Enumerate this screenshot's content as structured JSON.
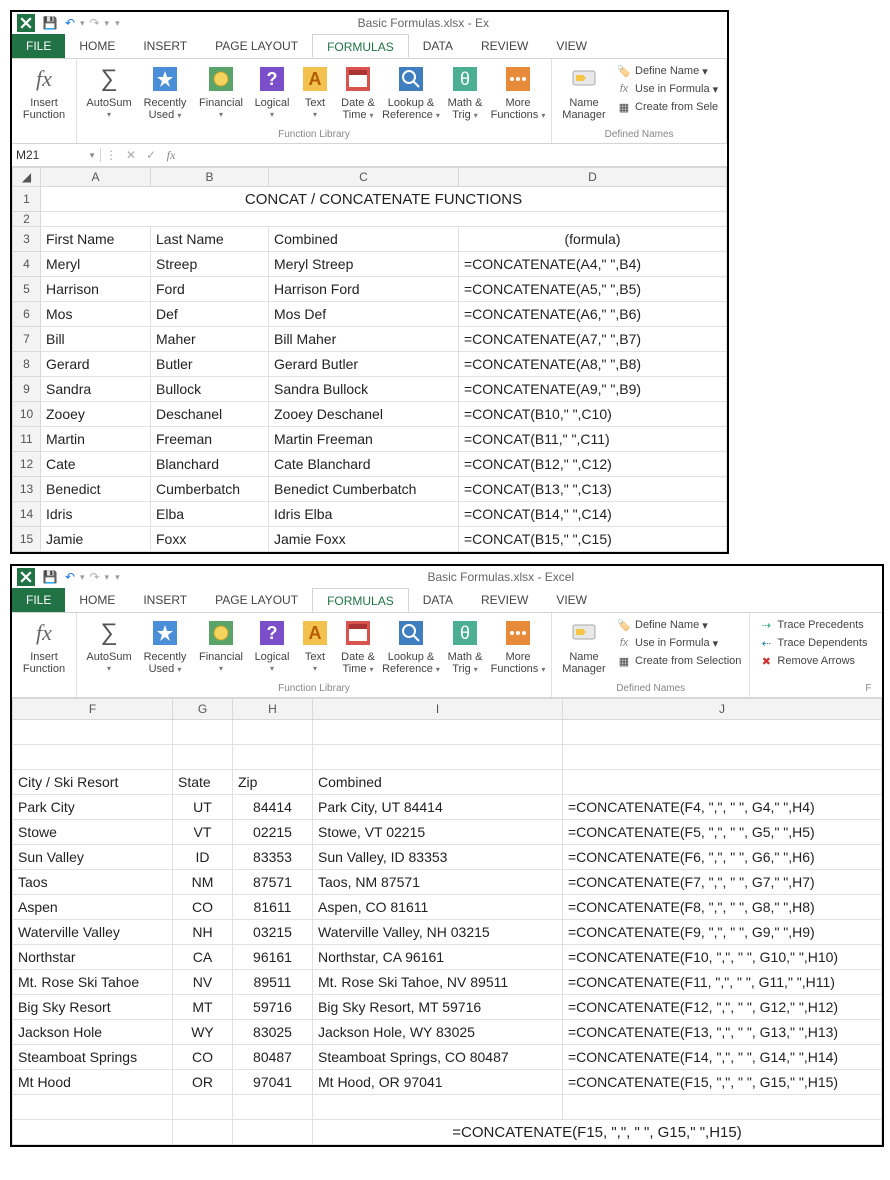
{
  "app_title": "Basic Formulas.xlsx - Ex",
  "app_title_full": "Basic Formulas.xlsx - Excel",
  "tabs": [
    "FILE",
    "HOME",
    "INSERT",
    "PAGE LAYOUT",
    "FORMULAS",
    "DATA",
    "REVIEW",
    "VIEW"
  ],
  "namebox": "M21",
  "formula_input": "",
  "ribbon": {
    "insert_function": {
      "l1": "Insert",
      "l2": "Function"
    },
    "autosum": {
      "l1": "AutoSum"
    },
    "recently": {
      "l1": "Recently",
      "l2": "Used"
    },
    "financial": {
      "l1": "Financial"
    },
    "logical": {
      "l1": "Logical"
    },
    "text": {
      "l1": "Text"
    },
    "datetime": {
      "l1": "Date &",
      "l2": "Time"
    },
    "lookup": {
      "l1": "Lookup &",
      "l2": "Reference"
    },
    "math": {
      "l1": "Math &",
      "l2": "Trig"
    },
    "more": {
      "l1": "More",
      "l2": "Functions"
    },
    "name_mgr": {
      "l1": "Name",
      "l2": "Manager"
    },
    "group_funclib": "Function Library",
    "group_defined": "Defined Names",
    "group_formaudit": "F",
    "define_name": "Define Name",
    "use_in_formula": "Use in Formula",
    "create_sel_short": "Create from Sele",
    "create_sel": "Create from Selection",
    "trace_prec": "Trace Precedents",
    "trace_dep": "Trace Dependents",
    "remove_arrows": "Remove Arrows"
  },
  "grid1": {
    "cols": [
      "A",
      "B",
      "C",
      "D"
    ],
    "title": "CONCAT / CONCATENATE FUNCTIONS",
    "headers": [
      "First Name",
      "Last Name",
      "Combined",
      "(formula)"
    ],
    "rows": [
      {
        "n": "4",
        "a": "Meryl",
        "b": "Streep",
        "c": "Meryl Streep",
        "d": "=CONCATENATE(A4,\" \",B4)"
      },
      {
        "n": "5",
        "a": "Harrison",
        "b": "Ford",
        "c": "Harrison Ford",
        "d": "=CONCATENATE(A5,\" \",B5)"
      },
      {
        "n": "6",
        "a": "Mos",
        "b": "Def",
        "c": "Mos Def",
        "d": "=CONCATENATE(A6,\" \",B6)"
      },
      {
        "n": "7",
        "a": "Bill",
        "b": "Maher",
        "c": "Bill Maher",
        "d": "=CONCATENATE(A7,\" \",B7)"
      },
      {
        "n": "8",
        "a": "Gerard",
        "b": "Butler",
        "c": "Gerard Butler",
        "d": "=CONCATENATE(A8,\" \",B8)"
      },
      {
        "n": "9",
        "a": "Sandra",
        "b": "Bullock",
        "c": "Sandra Bullock",
        "d": "=CONCATENATE(A9,\" \",B9)"
      },
      {
        "n": "10",
        "a": "Zooey",
        "b": "Deschanel",
        "c": "Zooey Deschanel",
        "d": "=CONCAT(B10,\" \",C10)"
      },
      {
        "n": "11",
        "a": "Martin",
        "b": "Freeman",
        "c": "Martin Freeman",
        "d": "=CONCAT(B11,\" \",C11)"
      },
      {
        "n": "12",
        "a": "Cate",
        "b": "Blanchard",
        "c": "Cate Blanchard",
        "d": "=CONCAT(B12,\" \",C12)"
      },
      {
        "n": "13",
        "a": "Benedict",
        "b": "Cumberbatch",
        "c": "Benedict Cumberbatch",
        "d": "=CONCAT(B13,\" \",C13)"
      },
      {
        "n": "14",
        "a": "Idris",
        "b": "Elba",
        "c": "Idris Elba",
        "d": "=CONCAT(B14,\" \",C14)"
      },
      {
        "n": "15",
        "a": "Jamie",
        "b": "Foxx",
        "c": "Jamie Foxx",
        "d": "=CONCAT(B15,\" \",C15)"
      }
    ]
  },
  "grid2": {
    "cols": [
      "F",
      "G",
      "H",
      "I",
      "J"
    ],
    "headers": [
      "City / Ski Resort",
      "State",
      "Zip",
      "Combined",
      ""
    ],
    "prefix": "=CONCATENATE(",
    "rows": [
      {
        "f": "Park City",
        "g": "UT",
        "h": "84414",
        "i": "Park City, UT 84414",
        "j": "=CONCATENATE(F4, \",\", \" \", G4,\" \",H4)"
      },
      {
        "f": "Stowe",
        "g": "VT",
        "h": "02215",
        "i": "Stowe, VT 02215",
        "j": "=CONCATENATE(F5, \",\", \" \", G5,\" \",H5)"
      },
      {
        "f": "Sun Valley",
        "g": "ID",
        "h": "83353",
        "i": "Sun Valley, ID 83353",
        "j": "=CONCATENATE(F6, \",\", \" \", G6,\" \",H6)"
      },
      {
        "f": "Taos",
        "g": "NM",
        "h": "87571",
        "i": "Taos, NM 87571",
        "j": "=CONCATENATE(F7, \",\", \" \", G7,\" \",H7)"
      },
      {
        "f": "Aspen",
        "g": "CO",
        "h": "81611",
        "i": "Aspen, CO 81611",
        "j": "=CONCATENATE(F8, \",\", \" \", G8,\" \",H8)"
      },
      {
        "f": "Waterville Valley",
        "g": "NH",
        "h": "03215",
        "i": "Waterville Valley, NH 03215",
        "j": "=CONCATENATE(F9, \",\", \" \", G9,\" \",H9)"
      },
      {
        "f": "Northstar",
        "g": "CA",
        "h": "96161",
        "i": "Northstar, CA 96161",
        "j": "=CONCATENATE(F10, \",\", \" \", G10,\" \",H10)"
      },
      {
        "f": "Mt. Rose Ski Tahoe",
        "g": "NV",
        "h": "89511",
        "i": "Mt. Rose Ski Tahoe, NV 89511",
        "j": "=CONCATENATE(F11, \",\", \" \", G11,\" \",H11)"
      },
      {
        "f": "Big Sky Resort",
        "g": "MT",
        "h": "59716",
        "i": "Big Sky Resort, MT 59716",
        "j": "=CONCATENATE(F12, \",\", \" \", G12,\" \",H12)"
      },
      {
        "f": "Jackson Hole",
        "g": "WY",
        "h": "83025",
        "i": "Jackson Hole, WY 83025",
        "j": "=CONCATENATE(F13, \",\", \" \", G13,\" \",H13)"
      },
      {
        "f": "Steamboat Springs",
        "g": "CO",
        "h": "80487",
        "i": "Steamboat Springs, CO 80487",
        "j": "=CONCATENATE(F14, \",\", \" \", G14,\" \",H14)"
      },
      {
        "f": "Mt Hood",
        "g": "OR",
        "h": "97041",
        "i": "Mt Hood, OR 97041",
        "j": "=CONCATENATE(F15, \",\", \" \", G15,\" \",H15)"
      }
    ],
    "footer_formula_parts": {
      "a": "=CONCATENATE(F15, ",
      "b": "\",\"",
      "c": ", ",
      "d": "\" \"",
      "e": ", G15,",
      "f": "\" \"",
      "g": ",H15)"
    }
  }
}
